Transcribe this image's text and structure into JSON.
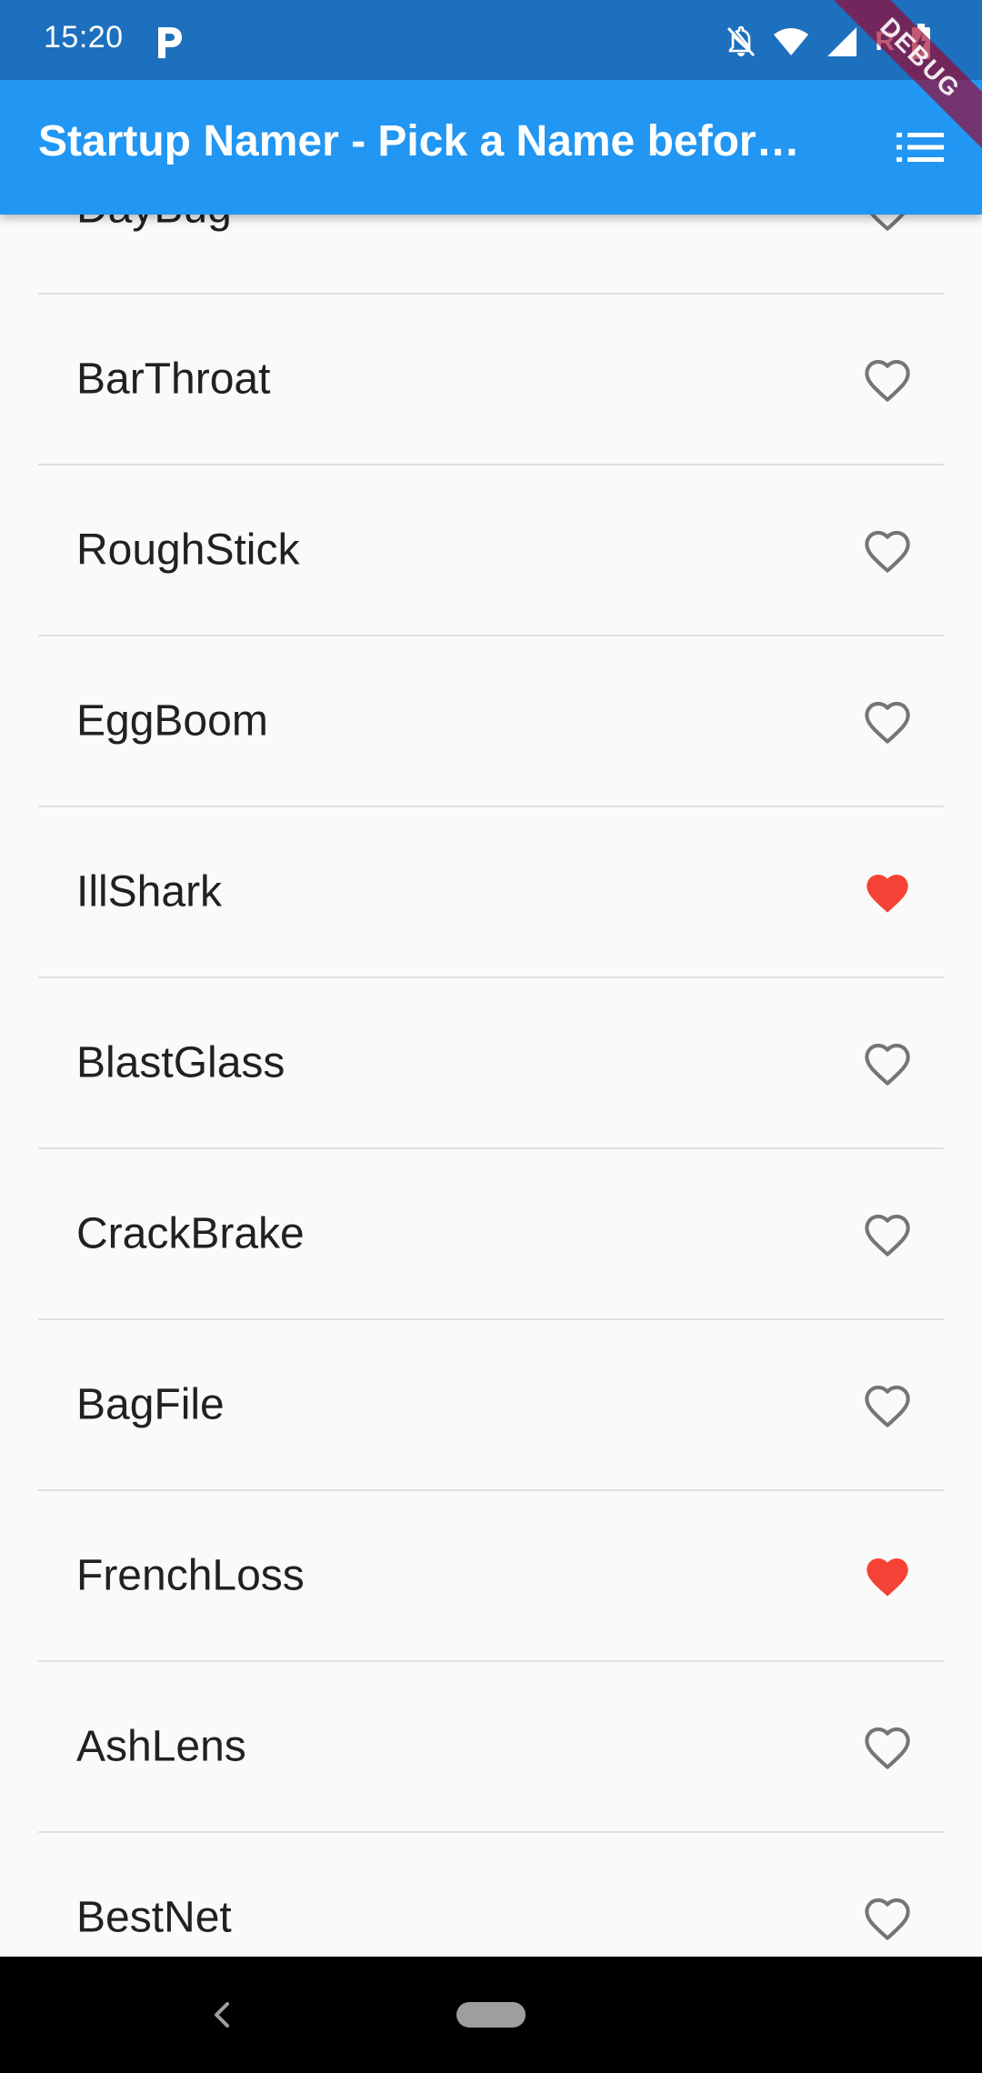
{
  "status_bar": {
    "time": "15:20",
    "roaming_label": "R",
    "icons": [
      "parking-icon",
      "notifications-off-icon",
      "wifi-icon",
      "signal-icon",
      "battery-charging-icon"
    ]
  },
  "app_bar": {
    "title": "Startup Namer - Pick a Name before…",
    "menu_icon": "list-icon",
    "background_color": "#2196f3"
  },
  "debug_banner": {
    "label": "DEBUG"
  },
  "list": {
    "items": [
      {
        "label": "DayBug",
        "favorite": false
      },
      {
        "label": "BarThroat",
        "favorite": false
      },
      {
        "label": "RoughStick",
        "favorite": false
      },
      {
        "label": "EggBoom",
        "favorite": false
      },
      {
        "label": "IllShark",
        "favorite": true
      },
      {
        "label": "BlastGlass",
        "favorite": false
      },
      {
        "label": "CrackBrake",
        "favorite": false
      },
      {
        "label": "BagFile",
        "favorite": false
      },
      {
        "label": "FrenchLoss",
        "favorite": true
      },
      {
        "label": "AshLens",
        "favorite": false
      },
      {
        "label": "BestNet",
        "favorite": false
      }
    ],
    "favorite_color": "#f44336",
    "unfavorite_color": "#757575"
  },
  "nav_bar": {
    "icons": [
      "back-icon",
      "home-pill-icon"
    ]
  }
}
